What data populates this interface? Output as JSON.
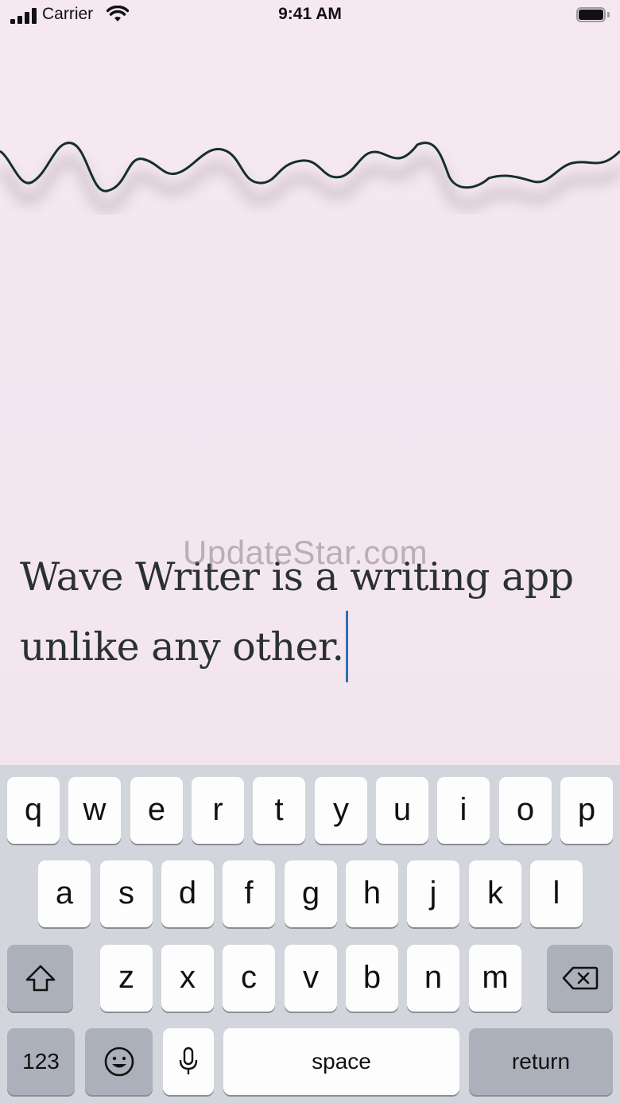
{
  "status_bar": {
    "carrier": "Carrier",
    "time": "9:41 AM"
  },
  "editor": {
    "text": "Wave Writer is a writing app unlike any other."
  },
  "watermark": "UpdateStar.com",
  "keyboard": {
    "row1": [
      "q",
      "w",
      "e",
      "r",
      "t",
      "y",
      "u",
      "i",
      "o",
      "p"
    ],
    "row2": [
      "a",
      "s",
      "d",
      "f",
      "g",
      "h",
      "j",
      "k",
      "l"
    ],
    "row3": [
      "z",
      "x",
      "c",
      "v",
      "b",
      "n",
      "m"
    ],
    "numbers_label": "123",
    "space_label": "space",
    "return_label": "return"
  },
  "colors": {
    "background": "#f6e8f1",
    "wave_stroke": "#14302b",
    "caret": "#2e6fb5",
    "keyboard_bg": "#d2d5db"
  }
}
